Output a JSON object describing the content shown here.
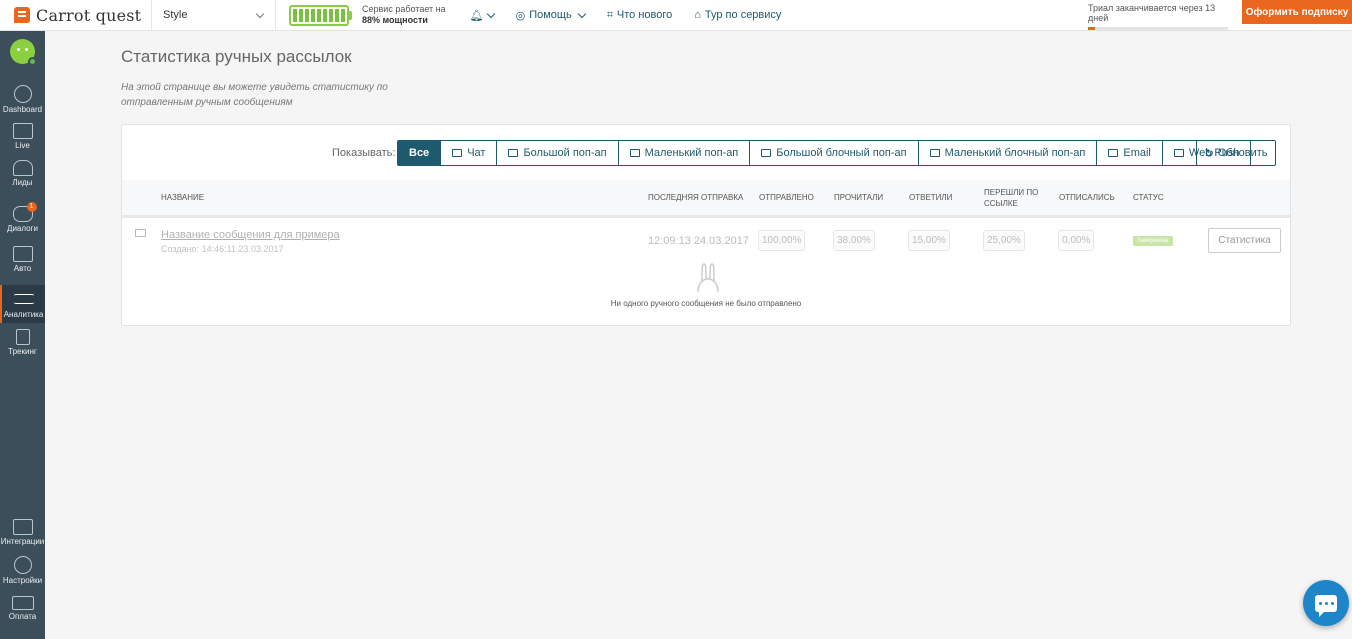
{
  "topbar": {
    "logo_text": "Carrot quest",
    "project": "Style",
    "service_line1": "Сервис работает на",
    "service_line2": "88% мощности",
    "help": "Помощь",
    "whats_new": "Что нового",
    "tour": "Тур по сервису",
    "trial": "Триал заканчивается через 13 дней",
    "subscribe": "Оформить подписку"
  },
  "sidebar": {
    "items": [
      {
        "label": "Dashboard",
        "icon": "gauge-icon"
      },
      {
        "label": "Live",
        "icon": "pulse-icon"
      },
      {
        "label": "Лиды",
        "icon": "users-icon"
      },
      {
        "label": "Диалоги",
        "icon": "chat-icon",
        "badge": "1"
      },
      {
        "label": "Авто",
        "icon": "auto-message-icon"
      },
      {
        "label": "Аналитика",
        "icon": "analytics-icon"
      },
      {
        "label": "Трекинг",
        "icon": "cursor-icon"
      },
      {
        "label": "Интеграции",
        "icon": "puzzle-icon"
      },
      {
        "label": "Настройки",
        "icon": "gear-icon"
      },
      {
        "label": "Оплата",
        "icon": "card-icon"
      }
    ]
  },
  "main": {
    "title": "Статистика ручных рассылок",
    "description": "На этой странице вы можете увидеть статистику по отправленным ручным сообщениям",
    "filter_label": "Показывать:",
    "filters": [
      "Все",
      "Чат",
      "Большой поп-ап",
      "Маленький поп-ап",
      "Большой блочный поп-ап",
      "Маленький блочный поп-ап",
      "Email",
      "Web Push"
    ],
    "refresh": "Обновить",
    "columns": [
      "Название",
      "Последняя отправка",
      "Отправлено",
      "Прочитали",
      "Ответили",
      "Перешли по ссылке",
      "Отписались",
      "Статус"
    ],
    "row": {
      "name": "Название сообщения для примера",
      "created": "Создано: 14:46:11 23.03.2017",
      "last_sent": "12:09:13 24.03.2017",
      "sent": "100,00%",
      "read": "38,00%",
      "replied": "15,00%",
      "clicked": "25,00%",
      "unsubscribed": "0,00%",
      "status": "Завершена",
      "stats_button": "Статистика"
    },
    "empty_text": "Ни одного ручного сообщения не было отправлено"
  },
  "colors": {
    "accent": "#e8661e",
    "primary": "#1e5a6e",
    "sidebar": "#3d4e5b",
    "chat": "#1e86c8"
  }
}
